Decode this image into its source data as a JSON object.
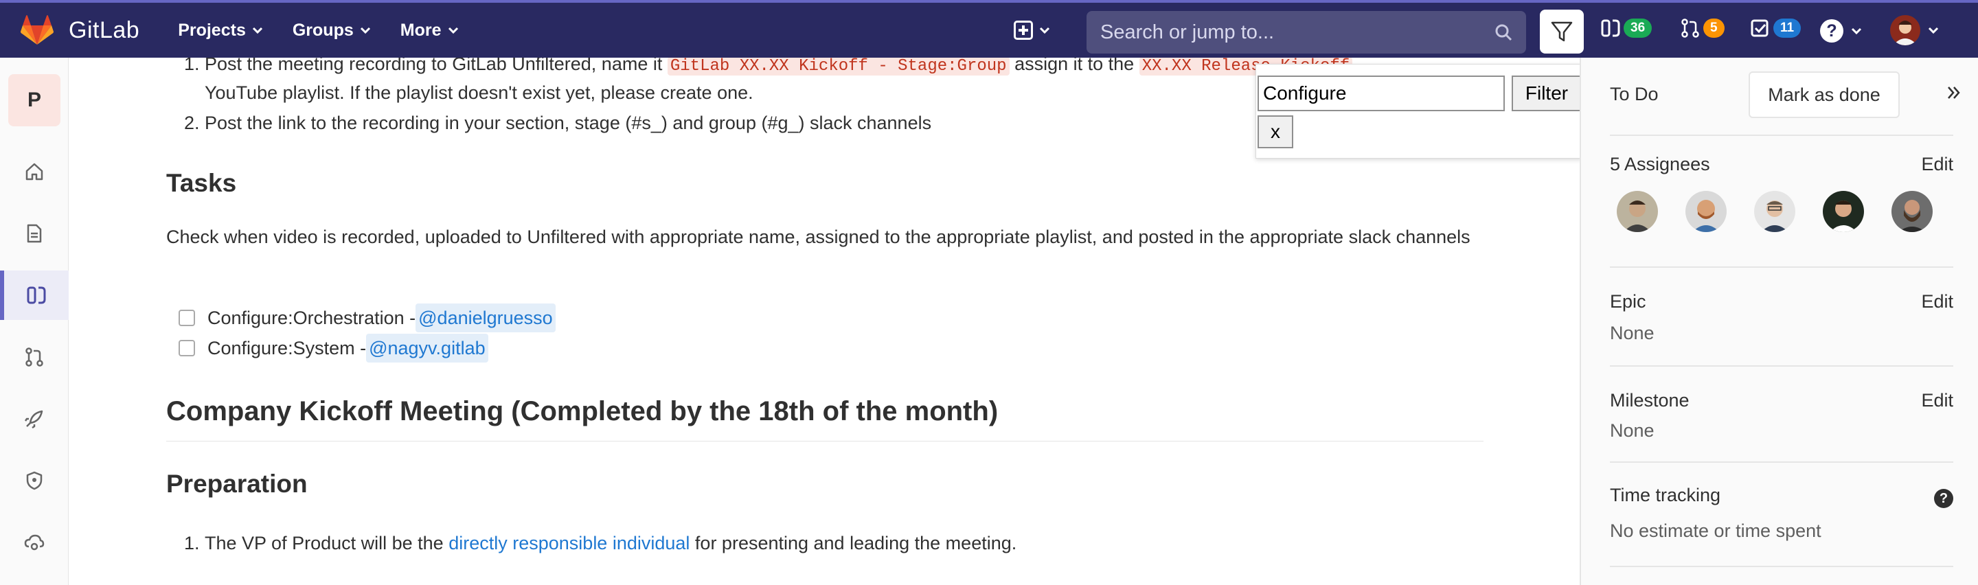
{
  "app": {
    "brand": "GitLab"
  },
  "nav": {
    "items": [
      {
        "label": "Projects"
      },
      {
        "label": "Groups"
      },
      {
        "label": "More"
      }
    ],
    "search_placeholder": "Search or jump to...",
    "issues_count": "36",
    "merge_requests_count": "5",
    "todos_count": "11",
    "help_label": "?"
  },
  "sidebar": {
    "project_initial": "P"
  },
  "content": {
    "step1_a": "Post the meeting recording to GitLab Unfiltered, name it",
    "step1_code": "GitLab XX.XX Kickoff - Stage:Group",
    "step1_b": "assign it to the",
    "step1_code2": "XX.XX Release Kickoff",
    "step1_c": "YouTube playlist. If the playlist doesn't exist yet, please create one.",
    "step2": "Post the link to the recording in your section, stage (#s_) and group (#g_) slack channels",
    "num1": "1.",
    "num2": "2.",
    "tasks_heading": "Tasks",
    "tasks_para": "Check when video is recorded, uploaded to Unfiltered with appropriate name, assigned to the appropriate playlist, and posted in the appropriate slack channels",
    "tasks": [
      {
        "label": "Configure:Orchestration - ",
        "mention": "@danielgruesso"
      },
      {
        "label": "Configure:System - ",
        "mention": "@nagyv.gitlab"
      }
    ],
    "company_heading": "Company Kickoff Meeting (Completed by the 18th of the month)",
    "prep_heading": "Preparation",
    "prep_num": "1.",
    "prep_a": "The VP of Product will be the",
    "prep_link": "directly responsible individual",
    "prep_b": "for presenting and leading the meeting."
  },
  "filter_popup": {
    "input_value": "Configure",
    "filter_label": "Filter",
    "close_label": "x"
  },
  "right_sidebar": {
    "todo_label": "To Do",
    "mark_done_label": "Mark as done",
    "assignees_label": "5 Assignees",
    "edit_label": "Edit",
    "epic_label": "Epic",
    "epic_value": "None",
    "milestone_label": "Milestone",
    "milestone_value": "None",
    "time_label": "Time tracking",
    "time_value": "No estimate or time spent",
    "help_label": "?"
  },
  "colors": {
    "navbar": "#292961",
    "accent": "#6666c4",
    "issues_badge": "#1aaa55",
    "mr_badge": "#fc9403",
    "todo_badge": "#1f78d1",
    "link": "#1f78d1"
  }
}
